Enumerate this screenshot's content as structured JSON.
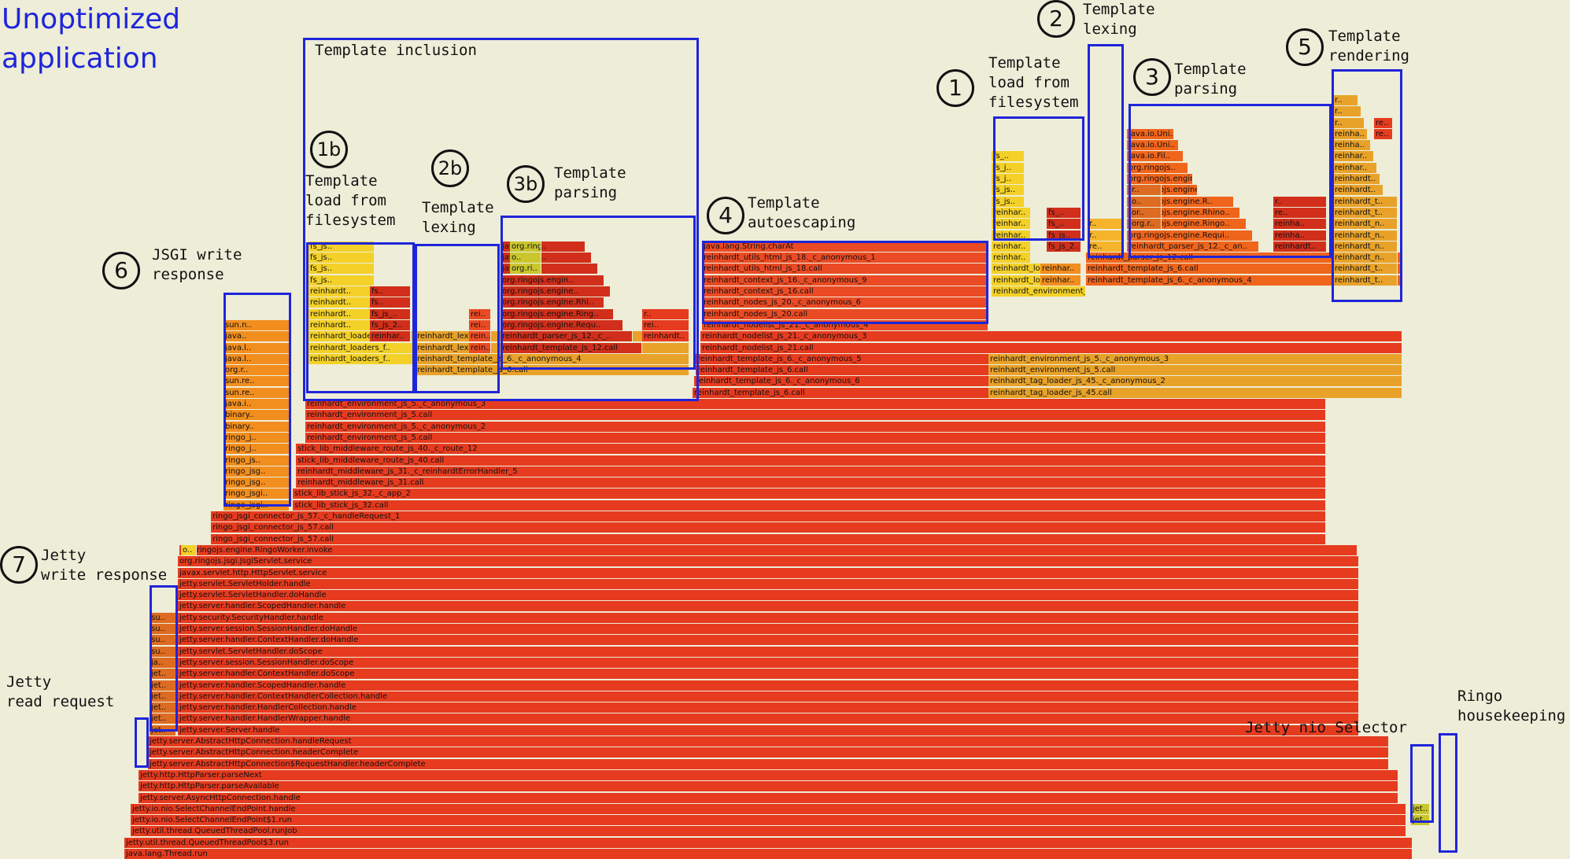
{
  "title": "Unoptimized\napplication",
  "colors": {
    "box": "#1f25d9",
    "background": "#ededd8",
    "palette": [
      "#e63b1f",
      "#f0651c",
      "#e8a22a",
      "#f4d128",
      "#dd6b22",
      "#f28e1e",
      "#d12f1b",
      "#c9c62e",
      "#eb4b24",
      "#f5b42c"
    ]
  },
  "annotations": [
    {
      "id": "1",
      "text": "Template\nload from\nfilesystem"
    },
    {
      "id": "2",
      "text": "Template\nlexing"
    },
    {
      "id": "3",
      "text": "Template\nparsing"
    },
    {
      "id": "4",
      "text": "Template\nautoescaping"
    },
    {
      "id": "5",
      "text": "Template\nrendering"
    },
    {
      "id": "6",
      "text": "JSGI write\nresponse"
    },
    {
      "id": "7",
      "text": "Jetty\nwrite response"
    },
    {
      "id": "1b",
      "text": "Template\nload from\nfilesystem"
    },
    {
      "id": "2b",
      "text": "Template\nlexing"
    },
    {
      "id": "3b",
      "text": "Template\nparsing"
    },
    {
      "id": "",
      "text": "Template inclusion"
    },
    {
      "id": "",
      "text": "Jetty\nread request"
    },
    {
      "id": "",
      "text": "Jetty nio Selector"
    },
    {
      "id": "",
      "text": "Ringo\nhousekeeping"
    }
  ],
  "frames": {
    "base": [
      "java.lang.Thread.run",
      "jetty.util.thread.QueuedThreadPool$3.run",
      "jetty.util.thread.QueuedThreadPool.runJob",
      "jetty.io.nio.SelectChannelEndPoint$1.run",
      "jetty.io.nio.SelectChannelEndPoint.handle",
      "jetty.server.AsyncHttpConnection.handle",
      "jetty.http.HttpParser.parseAvailable",
      "jetty.http.HttpParser.parseNext",
      "jetty.server.AbstractHttpConnection$RequestHandler.headerComplete",
      "jetty.server.AbstractHttpConnection.headerComplete",
      "jetty.server.AbstractHttpConnection.handleRequest",
      "jetty.server.Server.handle",
      "jetty.server.handler.HandlerWrapper.handle",
      "jetty.server.handler.HandlerCollection.handle",
      "jetty.server.handler.ContextHandlerCollection.handle",
      "jetty.server.handler.ScopedHandler.handle",
      "jetty.server.handler.ContextHandler.doScope",
      "jetty.server.session.SessionHandler.doScope",
      "jetty.servlet.ServletHandler.doScope",
      "jetty.server.handler.ContextHandler.doHandle",
      "jetty.server.session.SessionHandler.doHandle",
      "jetty.security.SecurityHandler.handle",
      "jetty.server.handler.ScopedHandler.handle",
      "jetty.servlet.ServletHandler.doHandle",
      "jetty.servlet.ServletHolder.handle",
      "javax.servlet.http.HttpServlet.service",
      "org.ringojs.jsgi.JsgiServlet.service",
      "org.ringojs.engine.RingoWorker.invoke",
      "ringo_jsgi_connector_js_57.call",
      "ringo_jsgi_connector_js_57.call",
      "ringo_jsgi_connector_js_57._c_handleRequest_1"
    ],
    "middle": [
      "stick_lib_stick_js_32.call",
      "stick_lib_stick_js_32._c_app_2",
      "reinhardt_middleware_js_31.call",
      "reinhardt_middleware_js_31._c_reinhardtErrorHandler_5",
      "stick_lib_middleware_route_js_40.call",
      "stick_lib_middleware_route_js_40._c_route_12",
      "reinhardt_environment_js_5.call",
      "reinhardt_environment_js_5._c_anonymous_2",
      "reinhardt_environment_js_5.call",
      "reinhardt_environment_js_5._c_anonymous_3"
    ],
    "inclusion_top": [
      "reinhardt_template_js_6.call",
      "reinhardt_template_js_6._c_anonymous_6",
      "reinhardt_template_js_6.call",
      "reinhardt_template_js_6._c_anonymous_5",
      "reinhardt_nodelist_js_21.call",
      "reinhardt_nodelist_js_21._c_anonymous_3"
    ],
    "right_low": [
      "reinhardt_tag_loader_js_45.call",
      "reinhardt_tag_loader_js_45._c_anonymous_2",
      "reinhardt_environment_js_5.call",
      "reinhardt_environment_js_5._c_anonymous_3"
    ],
    "autoescape": [
      "reinhardt_nodelist_js_21._c_anonymous_4",
      "reinhardt_nodes_js_20.call",
      "reinhardt_nodes_js_20._c_anonymous_6",
      "reinhardt_context_js_16.call",
      "reinhardt_context_js_16._c_anonymous_9",
      "reinhardt_utils_html_js_18.call",
      "reinhardt_utils_html_js_18._c_anonymous_1",
      "java.lang.String.charAt"
    ],
    "incl_left": [
      "reinhardt_template_js_6.call",
      "reinhardt_template_js_6._c_anonymous_4",
      "reinhardt_lexe..",
      "reinhardt_lexe.."
    ],
    "incl_load": [
      "reinhardt_loaders_f..",
      "reinhardt_loaders_f..",
      "reinhardt_loaders_f..",
      "reinhardt..",
      "reinhardt..",
      "reinhardt..",
      "reinhardt..",
      "fs_js..",
      "fs_js..",
      "fs_js..",
      "fs_js.."
    ],
    "incl_load2": [
      "reinhar..",
      "fs_js_2..",
      "fs_js_..",
      "fs..",
      "fs.."
    ],
    "incl_lex": [
      "rein..",
      "rein..",
      "rei..",
      "rei.."
    ],
    "incl_parse": [
      "reinhardt_template_js_12.call",
      "reinhardt_parser_js_12._c_..",
      "org.ringojs.engine.Requ..",
      "org.ringojs.engine.Ring..",
      "org.ringojs.engine.Rhi..",
      "org.ringojs.engine..",
      "org.ringojs.engin..",
      "java.io.Fi..",
      "java.io.Un..",
      "java.io.Un.."
    ],
    "incl_parse2": [
      "org.ri..",
      "o..",
      "org.ringoj.."
    ],
    "incl_parse_right": [
      "reinhardt..",
      "rei..",
      "r.."
    ],
    "load_filesystem": [
      "reinhardt_environment_js_5.call",
      "reinhardt_loaders..",
      "reinhardt_loaders..",
      "reinhar..",
      "reinhar..",
      "reinhar..",
      "reinhar..",
      "reinhar..",
      "fs_js..",
      "fs_js..",
      "fs_j..",
      "fs_j..",
      "fs_.."
    ],
    "load_filesystem2": [
      "fs_js_2..",
      "fs_js..",
      "fs_..",
      "fs_.."
    ],
    "load_filesystem3": [
      "reinhar..",
      "reinhar.."
    ],
    "lexing": [
      "rein..",
      "rein..",
      "re..",
      "re..",
      "r..",
      "r.."
    ],
    "parsing_base": [
      "reinhardt_template_js_6._c_anonymous_4",
      "reinhardt_template_js_6.call",
      "reinhardt_parser_js_12.call"
    ],
    "parsing": [
      "reinhardt_parser_js_12._c_an..",
      "org.ringojs.engine.Requi..",
      "org.ringojs.engine.Ringo..",
      "org.ringojs.engine.Rhino..",
      "org.ringojs.engine.R..",
      "org.ringojs.engine..",
      "org.ringojs.engine..",
      "org.ringojs..",
      "java.io.Fil..",
      "java.io.Uni..",
      "java.io.Uni.."
    ],
    "parsing_left": [
      "org.r..",
      "or..",
      "o..",
      "r.."
    ],
    "parsing_right": [
      "reinhardt..",
      "reinha..",
      "reinha..",
      "re..",
      "r.."
    ],
    "rendering": [
      "reinhardt_t..",
      "reinhardt_t..",
      "reinhardt_n..",
      "reinhardt_n..",
      "reinhardt_n..",
      "reinhardt_n..",
      "reinhardt_t..",
      "reinhardt_t..",
      "reinhardt..",
      "reinhardt..",
      "reinhar..",
      "reinhar..",
      "reinha..",
      "reinha..",
      "r..",
      "r..",
      "r.."
    ],
    "rendering2": [
      "re..",
      "re.."
    ],
    "jsgi_write": [
      "ringo_jsgi..",
      "ringo_jsgi..",
      "ringo_jsg..",
      "ringo_jsg..",
      "ringo_js..",
      "ringo_j..",
      "ringo_j..",
      "binary..",
      "binary..",
      "java.i..",
      "sun.re..",
      "sun.re..",
      "org.r..",
      "java.l..",
      "java.l..",
      "java..",
      "sun.n.."
    ],
    "jetty_write": [
      "jet..",
      "jet..",
      "jet..",
      "jet..",
      "jet..",
      "jet..",
      "ja..",
      "su..",
      "su..",
      "su..",
      "su.."
    ],
    "selector": [
      "jet..",
      "jet.."
    ],
    "misc_small": [
      "o.."
    ]
  }
}
